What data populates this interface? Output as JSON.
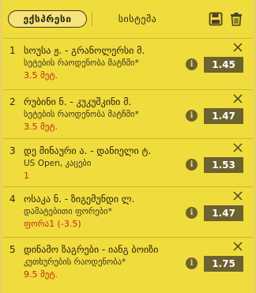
{
  "tabs": [
    {
      "label": "ექსპრესი",
      "active": true
    },
    {
      "label": "სისტემა",
      "active": false
    }
  ],
  "toolbar": {
    "save_icon": "save-icon",
    "trash_icon": "trash-icon"
  },
  "colors": {
    "background": "#f1dc3d",
    "odds_bg": "#6c622f",
    "selection_text": "#c02818",
    "info_bg": "#6b6233"
  },
  "bets": [
    {
      "num": "1",
      "match": "სოუსა ჟ. - გრანოლერსი მ.",
      "market": "სეტების რაოდენობა მატჩში*",
      "selection": "3.5 მეტ.",
      "odds": "1.45"
    },
    {
      "num": "2",
      "match": "რუბინი ნ. - კუკუშკინი მ.",
      "market": "სეტების რაოდენობა მატჩში*",
      "selection": "3.5 მეტ.",
      "odds": "1.47"
    },
    {
      "num": "3",
      "match": "დე მინაური ა. - დანიელი ტ.",
      "market": "US Open, კაცები",
      "selection": "1",
      "odds": "1.53"
    },
    {
      "num": "4",
      "match": "ოსაკა ნ. - ზიგემუნდი ლ.",
      "market": "დამატებითი ფორები*",
      "selection": "ფორა1 (-3.5)",
      "odds": "1.47"
    },
    {
      "num": "5",
      "match": "დინამო ზაგრები - იანგ ბოიზი",
      "market": "კუთხურების რაოდენობა*",
      "selection": "9.5 მეტ.",
      "odds": "1.75"
    }
  ]
}
